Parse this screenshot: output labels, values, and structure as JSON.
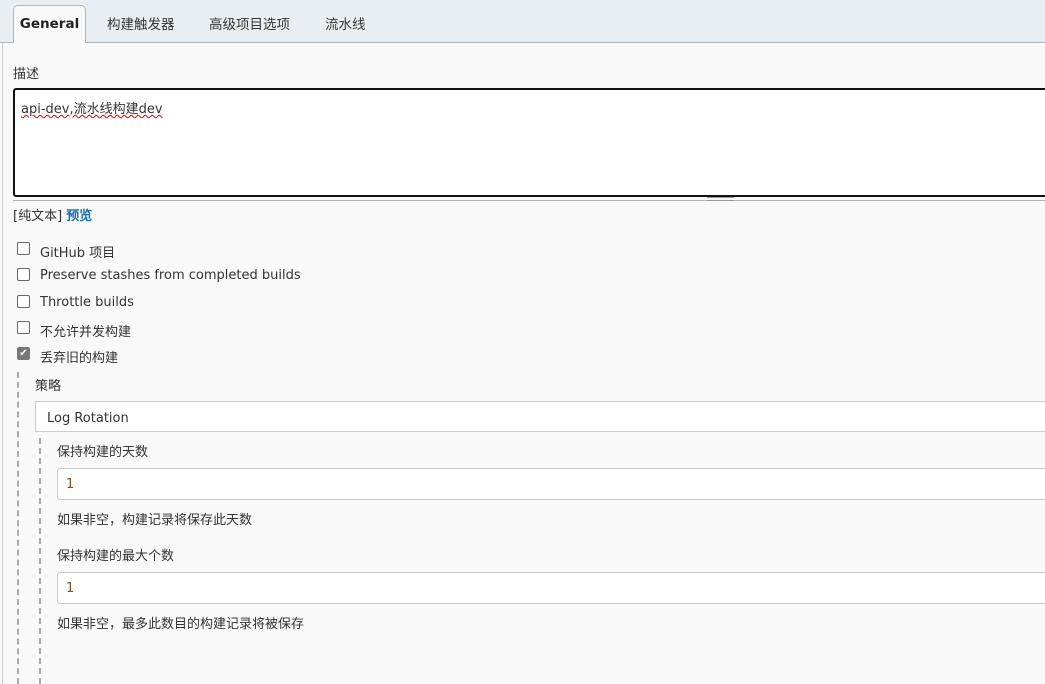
{
  "tabs": [
    {
      "label": "General"
    },
    {
      "label": "构建触发器"
    },
    {
      "label": "高级项目选项"
    },
    {
      "label": "流水线"
    }
  ],
  "description": {
    "label": "描述",
    "value": "api-dev,流水线构建dev",
    "plain_text": "[纯文本]",
    "preview": "预览"
  },
  "options": [
    {
      "label": "GitHub 项目",
      "checked": false
    },
    {
      "label": "Preserve stashes from completed builds",
      "checked": false
    },
    {
      "label": "Throttle builds",
      "checked": false
    },
    {
      "label": "不允许并发构建",
      "checked": false
    },
    {
      "label": "丢弃旧的构建",
      "checked": true
    }
  ],
  "strategy": {
    "label": "策略",
    "value": "Log Rotation",
    "days_label": "保持构建的天数",
    "days_value": "1",
    "days_help": "如果非空，构建记录将保存此天数",
    "max_label": "保持构建的最大个数",
    "max_value": "1",
    "max_help": "如果非空，最多此数目的构建记录将被保存"
  }
}
